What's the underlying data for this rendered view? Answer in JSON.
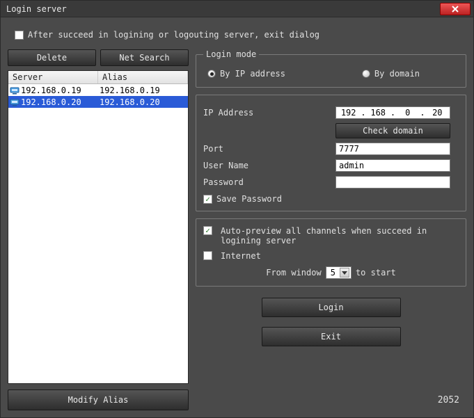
{
  "window": {
    "title": "Login server"
  },
  "topCheckbox": {
    "label": "After succeed in logining or logouting server, exit dialog",
    "checked": false
  },
  "leftPanel": {
    "deleteLabel": "Delete",
    "netSearchLabel": "Net Search",
    "columns": {
      "server": "Server",
      "alias": "Alias"
    },
    "rows": [
      {
        "server": "192.168.0.19",
        "alias": "192.168.0.19",
        "selected": false
      },
      {
        "server": "192.168.0.20",
        "alias": "192.168.0.20",
        "selected": true
      }
    ],
    "modifyAliasLabel": "Modify Alias"
  },
  "loginMode": {
    "legend": "Login mode",
    "byIpLabel": "By IP address",
    "byDomainLabel": "By domain",
    "selected": "ip"
  },
  "form": {
    "ipLabel": "IP Address",
    "ip": [
      "192",
      "168",
      "0",
      "20"
    ],
    "checkDomainLabel": "Check domain",
    "portLabel": "Port",
    "port": "7777",
    "userLabel": "User Name",
    "user": "admin",
    "passwordLabel": "Password",
    "password": "",
    "savePasswordLabel": "Save Password",
    "savePasswordChecked": true
  },
  "auto": {
    "autoPreview": {
      "label": "Auto-preview all channels when succeed in logining server",
      "checked": true
    },
    "internet": {
      "label": "Internet",
      "checked": false
    },
    "fromWindowPrefix": "From window",
    "fromWindowValue": "5",
    "fromWindowSuffix": "to start"
  },
  "actions": {
    "loginLabel": "Login",
    "exitLabel": "Exit"
  },
  "footer": {
    "number": "2052"
  }
}
